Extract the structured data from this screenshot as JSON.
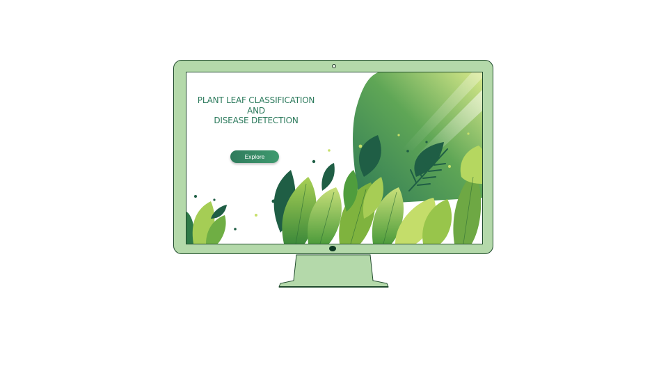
{
  "screen": {
    "headline_lines": [
      "PLANT LEAF CLASSIFICATION",
      "AND",
      "DISEASE DETECTION"
    ],
    "explore_label": "Explore"
  },
  "icons": {
    "camera": "camera-dot-icon",
    "power": "power-button-icon"
  },
  "colors": {
    "monitor_frame": "#b4d9aa",
    "monitor_outline": "#1f4a2c",
    "headline_text": "#2c7a5c",
    "button_fill": "#2f7b5c",
    "leaf_dark": "#1f5e45",
    "leaf_light": "#a9cc4a"
  }
}
